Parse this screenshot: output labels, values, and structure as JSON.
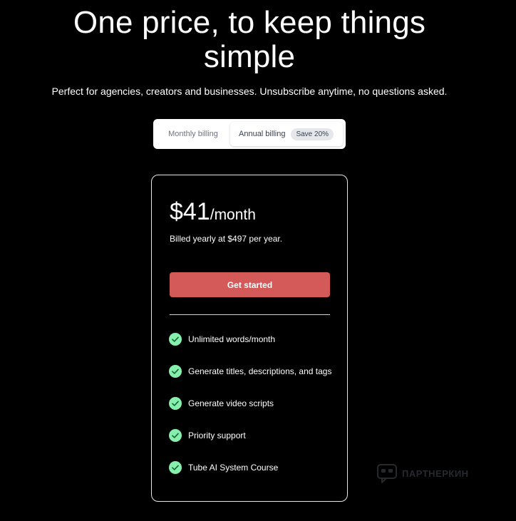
{
  "hero": {
    "title_line1": "One price, to keep things",
    "title_line2": "simple",
    "subtitle": "Perfect for agencies, creators and businesses. Unsubscribe anytime, no questions asked."
  },
  "billing_toggle": {
    "monthly_label": "Monthly billing",
    "annual_label": "Annual billing",
    "save_badge": "Save 20%",
    "selected": "annual"
  },
  "plan": {
    "price": "$41",
    "period": "/month",
    "billed_note": "Billed yearly at $497 per year.",
    "cta_label": "Get started",
    "features": [
      {
        "label": "Unlimited words/month",
        "icon": "check-circle-icon"
      },
      {
        "label": "Generate titles, descriptions, and tags",
        "icon": "check-circle-icon"
      },
      {
        "label": "Generate video scripts",
        "icon": "check-circle-icon"
      },
      {
        "label": "Priority support",
        "icon": "check-circle-icon"
      },
      {
        "label": "Tube AI System Course",
        "icon": "check-circle-icon"
      }
    ]
  },
  "watermark": {
    "text": "ПАРТНЕРКИН",
    "icon": "partnerkin-logo-icon"
  },
  "colors": {
    "background": "#000000",
    "cta": "#d45a5a",
    "check": "#86efac",
    "card_border": "#e5e7eb"
  }
}
